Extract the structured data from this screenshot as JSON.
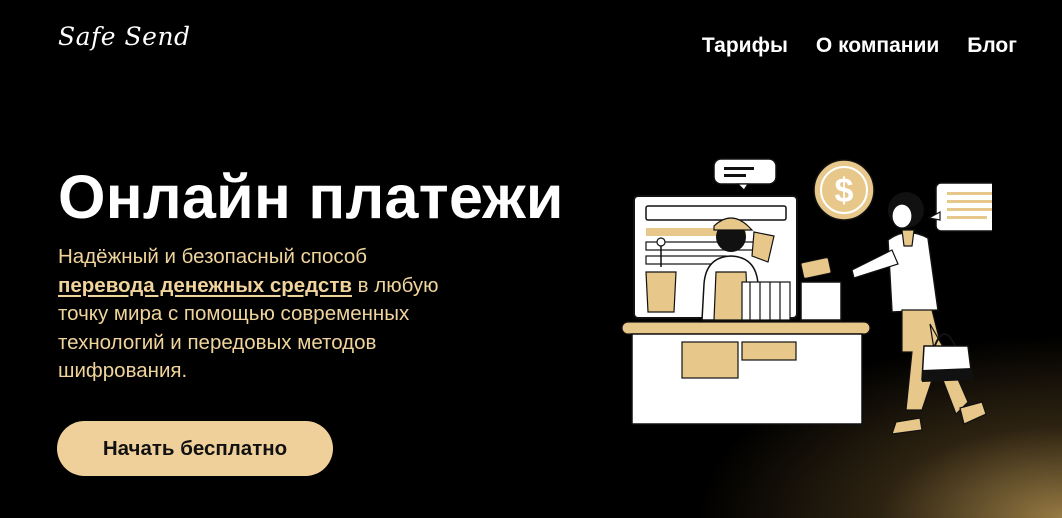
{
  "header": {
    "logo": "Safe Send",
    "nav": [
      {
        "label": "Тарифы"
      },
      {
        "label": "О компании"
      },
      {
        "label": "Блог"
      }
    ]
  },
  "hero": {
    "title": "Онлайн платежи",
    "desc_before": "Надёжный и безопасный способ ",
    "desc_highlight": "перевода денежных средств",
    "desc_after": " в любую точку мира с помощью современных технологий и передовых методов шифрования.",
    "cta_label": "Начать бесплатно"
  },
  "illustration": {
    "coin_symbol": "$"
  },
  "colors": {
    "background": "#000000",
    "accent": "#f0d09a",
    "text_accent": "#f0d49c",
    "illustration_fill": "#e8c88a"
  }
}
